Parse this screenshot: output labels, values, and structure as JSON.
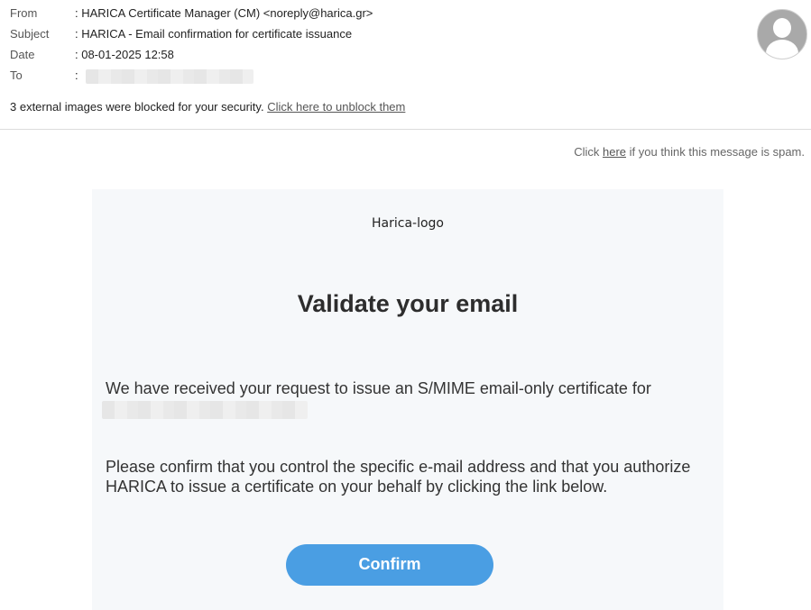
{
  "email_header": {
    "from_label": "From",
    "from_value": ": HARICA Certificate Manager (CM) <noreply@harica.gr>",
    "subject_label": "Subject",
    "subject_value": ": HARICA - Email confirmation for certificate issuance",
    "date_label": "Date",
    "date_value": ": 08-01-2025 12:58",
    "to_label": "To",
    "to_prefix": ":"
  },
  "avatar_icon": "user-avatar-icon",
  "blocked_notice": {
    "text": "3 external images were blocked for your security.",
    "link": "Click here to unblock them"
  },
  "spam_notice": {
    "prefix": "Click",
    "link": "here",
    "suffix": "if you think this message is spam."
  },
  "email_body": {
    "logo_alt": "Harica-logo",
    "title": "Validate your email",
    "request_text": "We have received your request to issue an S/MIME email-only certificate for",
    "confirm_text": "Please confirm that you control the specific e-mail address and that you authorize HARICA to issue a certificate on your behalf by clicking the link below.",
    "button_label": "Confirm"
  },
  "colors": {
    "button": "#4a9ee3",
    "card_background": "#f6f8fa"
  }
}
